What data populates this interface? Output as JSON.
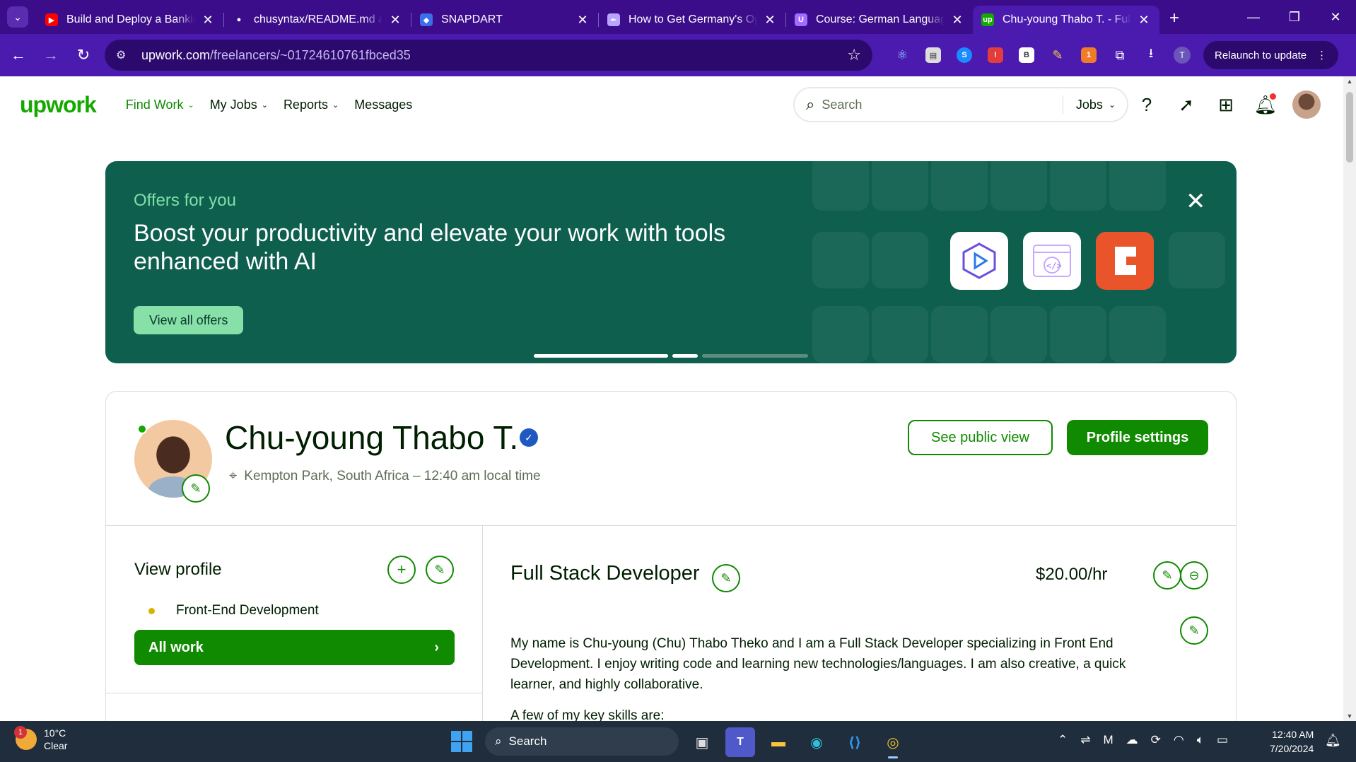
{
  "browser": {
    "tabs": [
      {
        "title": "Build and Deploy a Banking",
        "favicon": "youtube-icon",
        "color": "#ff0000",
        "glyph": "▶"
      },
      {
        "title": "chusyntax/README.md at",
        "favicon": "github-icon",
        "color": "#ffffff",
        "glyph": "●"
      },
      {
        "title": "SNAPDART",
        "favicon": "snapdart-icon",
        "color": "#3b6ee8",
        "glyph": "◆"
      },
      {
        "title": "How to Get Germany's Op",
        "favicon": "feather-icon",
        "color": "#b9a4ff",
        "glyph": "✒"
      },
      {
        "title": "Course: German Language",
        "favicon": "course-icon",
        "color": "#a36bff",
        "glyph": "U"
      },
      {
        "title": "Chu-young Thabo T. - Full",
        "favicon": "upwork-icon",
        "color": "#14a800",
        "glyph": "up",
        "active": true
      }
    ],
    "url_host": "upwork.com",
    "url_path": "/freelancers/~01724610761fbced35",
    "relaunch_label": "Relaunch to update",
    "profile_initial": "T"
  },
  "site": {
    "logo": "upwork",
    "nav": [
      {
        "label": "Find Work",
        "active": true
      },
      {
        "label": "My Jobs"
      },
      {
        "label": "Reports"
      },
      {
        "label": "Messages"
      }
    ],
    "search_placeholder": "Search",
    "search_scope": "Jobs"
  },
  "banner": {
    "eyebrow": "Offers for you",
    "headline": "Boost your productivity and elevate your work with tools enhanced with AI",
    "cta": "View all offers"
  },
  "profile": {
    "name": "Chu-young Thabo T.",
    "location": "Kempton Park, South Africa – 12:40 am local time",
    "see_public": "See public view",
    "settings": "Profile settings",
    "side_title": "View profile",
    "side_skill": "Front-End Development",
    "all_work": "All work",
    "job_title": "Full Stack Developer",
    "rate": "$20.00/hr",
    "bio": "My name is Chu-young (Chu) Thabo Theko and I am a Full Stack Developer specializing in Front End Development. I enjoy writing code and learning new technologies/languages. I am also creative, a quick learner, and highly collaborative.",
    "bio_next": "A few of my key skills are:"
  },
  "taskbar": {
    "temp": "10°C",
    "condition": "Clear",
    "weather_badge": "1",
    "search": "Search",
    "time": "12:40 AM",
    "date": "7/20/2024"
  }
}
